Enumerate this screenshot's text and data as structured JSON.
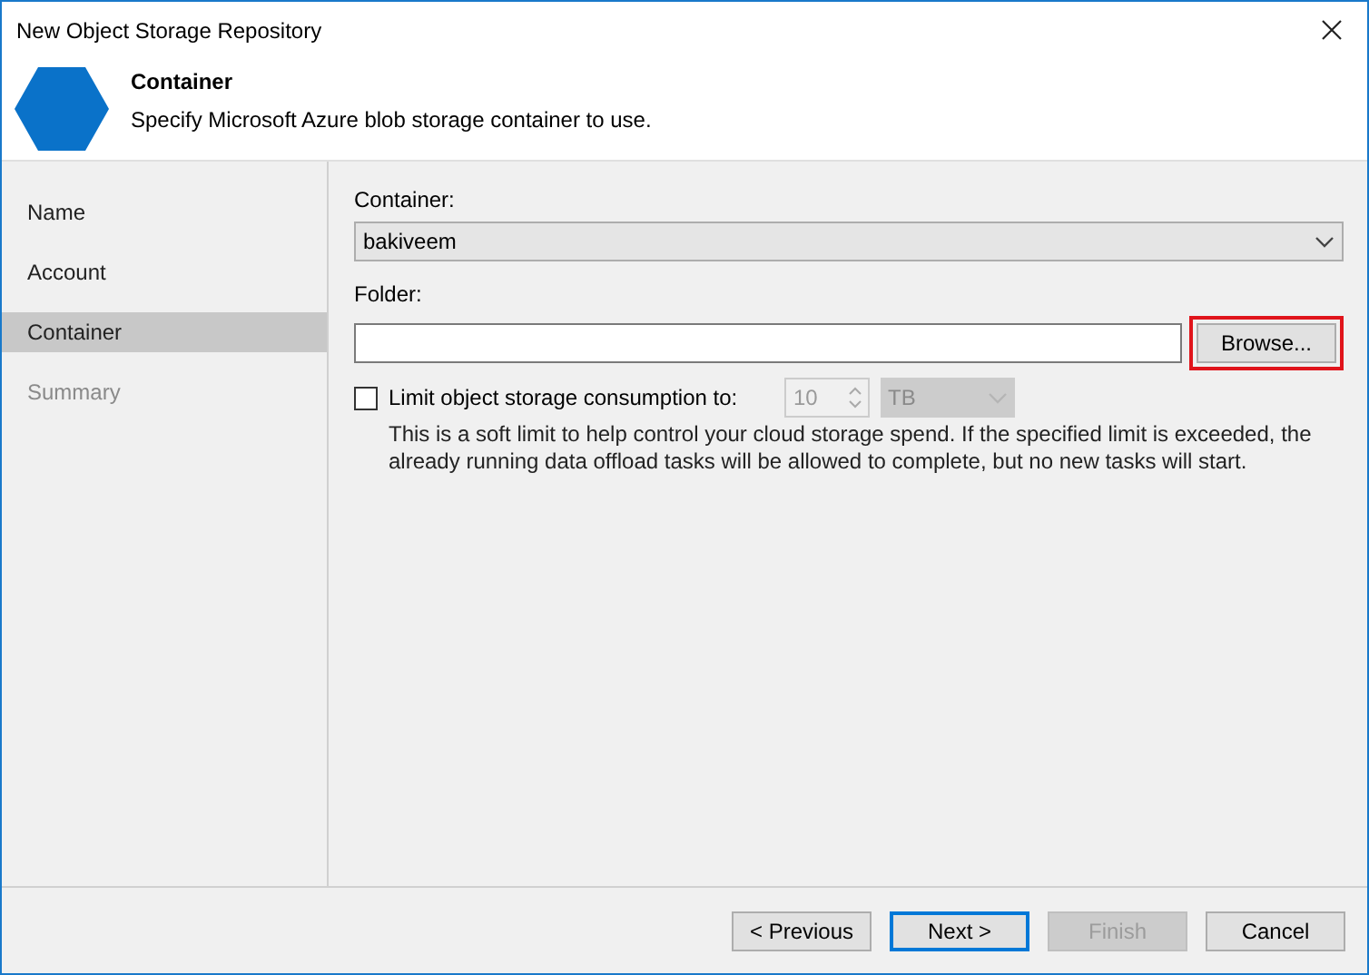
{
  "window": {
    "title": "New Object Storage Repository"
  },
  "header": {
    "title": "Container",
    "subtitle": "Specify Microsoft Azure blob storage container to use."
  },
  "sidebar": {
    "items": [
      {
        "label": "Name",
        "selected": false,
        "disabled": false
      },
      {
        "label": "Account",
        "selected": false,
        "disabled": false
      },
      {
        "label": "Container",
        "selected": true,
        "disabled": false
      },
      {
        "label": "Summary",
        "selected": false,
        "disabled": true
      }
    ]
  },
  "form": {
    "container": {
      "label": "Container:",
      "value": "bakiveem"
    },
    "folder": {
      "label": "Folder:",
      "browse": {
        "label": "Browse...",
        "highlighted": true
      }
    },
    "limit": {
      "label": "Limit object storage consumption to:",
      "checked": false,
      "amount": "10",
      "unit": "TB",
      "note": "This is a soft limit to help control your cloud storage spend. If the specified limit is exceeded, the already running data offload tasks will be allowed to complete, but no new tasks will start."
    }
  },
  "buttons": [
    {
      "label": "< Previous",
      "default": false,
      "disabled": false
    },
    {
      "label": "Next >",
      "default": true,
      "disabled": false
    },
    {
      "label": "Finish",
      "default": false,
      "disabled": true
    },
    {
      "label": "Cancel",
      "default": false,
      "disabled": false
    }
  ]
}
